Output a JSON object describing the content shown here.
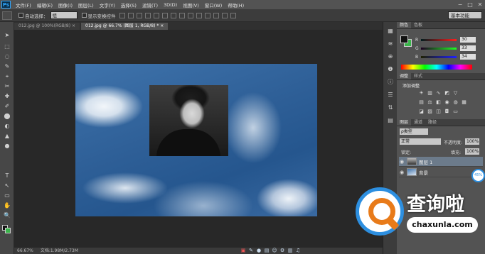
{
  "app": {
    "logo": "Ps"
  },
  "menubar": {
    "items": [
      "文件(F)",
      "编辑(E)",
      "图像(I)",
      "图层(L)",
      "文字(Y)",
      "选择(S)",
      "滤镜(T)",
      "3D(D)",
      "视图(V)",
      "窗口(W)",
      "帮助(H)"
    ],
    "min": "−",
    "max": "□",
    "close": "✕"
  },
  "options": {
    "auto_select_label": "自动选择：",
    "auto_select_value": "组",
    "transform_label": "显示变换控件",
    "workspace": "基本功能"
  },
  "tabs": [
    {
      "label": "012.jpg @ 100%(RGB/8) ×",
      "active": false
    },
    {
      "label": "012.jpg @ 66.7% (图层 1, RGB/8) * ×",
      "active": true
    }
  ],
  "tools": [
    "➤",
    "⬚",
    "◌",
    "✎",
    "⌖",
    "✂",
    "✚",
    "✐",
    "⬤",
    "◐",
    "▲",
    "●",
    "T",
    "↖",
    "▭",
    "✋",
    "🔍"
  ],
  "strip_icons": [
    "▦",
    "≋",
    "⊕",
    "❶",
    "ⓘ",
    "☰",
    "⇅",
    "▤"
  ],
  "color_panel": {
    "tabs": [
      "颜色",
      "色板"
    ],
    "r": "30",
    "g": "33",
    "b": "34",
    "r_letter": "R",
    "g_letter": "G",
    "b_letter": "B"
  },
  "adjust_panel": {
    "tabs": [
      "调整",
      "样式"
    ],
    "header": "添加调整"
  },
  "layers_panel": {
    "tabs": [
      "图层",
      "通道",
      "路径"
    ],
    "filter": "ρ类型",
    "blend": "正常",
    "opacity_label": "不透明度:",
    "opacity": "100%",
    "lock_label": "锁定:",
    "fill_label": "填充:",
    "fill": "100%",
    "layers": [
      {
        "name": "图层 1",
        "selected": true
      },
      {
        "name": "背景",
        "selected": false
      }
    ]
  },
  "status": {
    "zoom": "66.67%",
    "doc": "文档:1.98M/2.73M"
  },
  "watermark": {
    "title": "查询啦",
    "sub": "chaxunla.com"
  },
  "zoom_badge": "45%"
}
